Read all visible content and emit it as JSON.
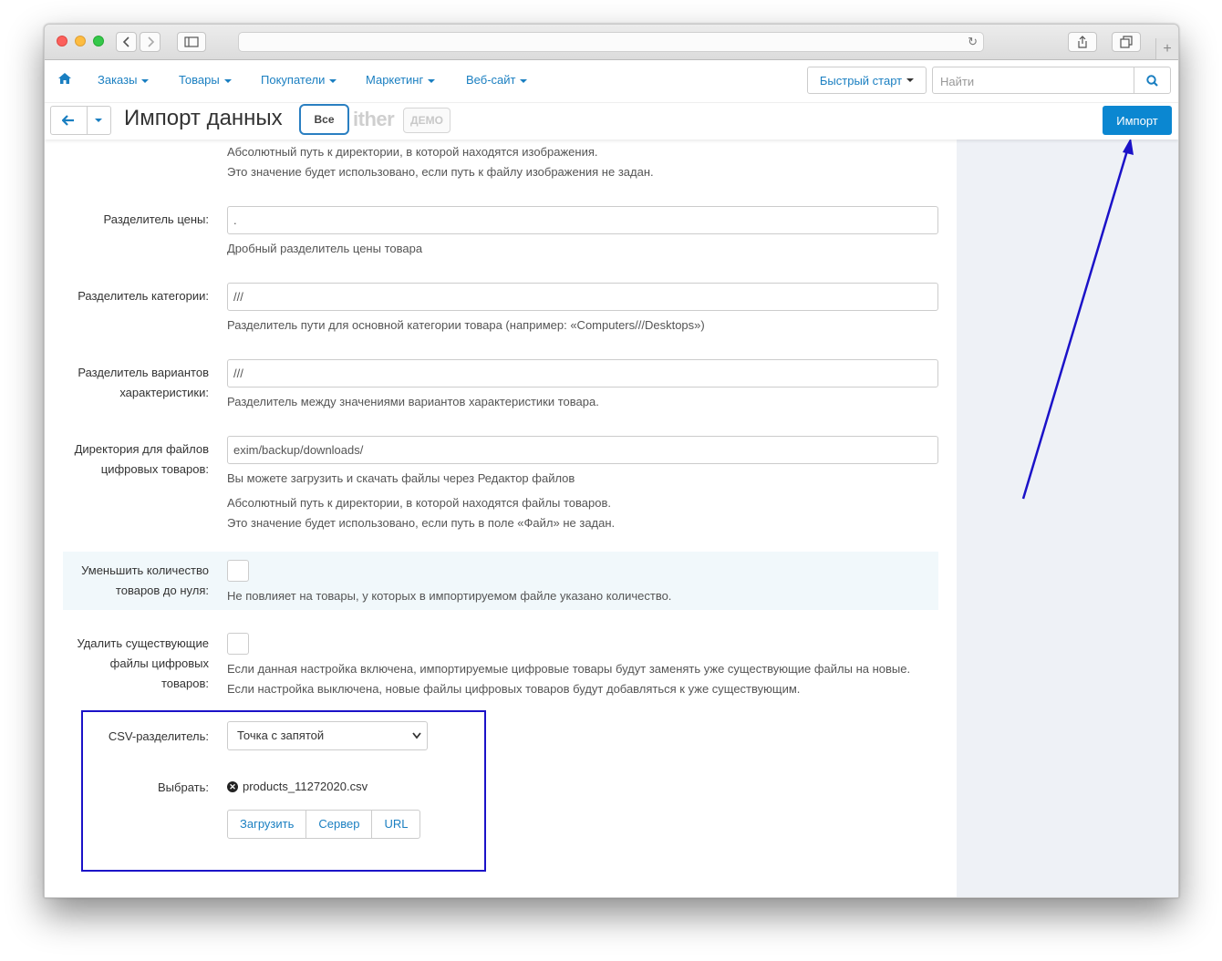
{
  "nav": {
    "items": [
      "Заказы",
      "Товары",
      "Покупатели",
      "Маркетинг",
      "Веб-сайт"
    ],
    "quick_start": "Быстрый старт",
    "search_placeholder": "Найти"
  },
  "toolbar": {
    "title": "Импорт данных",
    "vse_label": "Все",
    "logo_text": "ither",
    "demo_text": "ДЕМО",
    "import_label": "Импорт"
  },
  "form": {
    "images_dir_help1": "Абсолютный путь к директории, в которой находятся изображения.",
    "images_dir_help2": "Это значение будет использовано, если путь к файлу изображения не задан.",
    "price_sep": {
      "label": "Разделитель цены:",
      "value": ".",
      "help": "Дробный разделитель цены товара"
    },
    "cat_sep": {
      "label": "Разделитель категории:",
      "value": "///",
      "help": "Разделитель пути для основной категории товара (например: «Computers///Desktops»)"
    },
    "variant_sep": {
      "label1": "Разделитель вариантов",
      "label2": "характеристики:",
      "value": "///",
      "help": "Разделитель между значениями вариантов характеристики товара."
    },
    "digital_dir": {
      "label1": "Директория для файлов",
      "label2": "цифровых товаров:",
      "value": "exim/backup/downloads/",
      "help1": "Вы можете загрузить и скачать файлы через Редактор файлов",
      "help2": "Абсолютный путь к директории, в которой находятся файлы товаров.",
      "help3": "Это значение будет использовано, если путь в поле «Файл» не задан."
    },
    "reduce_qty": {
      "label1": "Уменьшить количество",
      "label2": "товаров до нуля:",
      "help": "Не повлияет на товары, у которых в импортируемом файле указано количество."
    },
    "delete_files": {
      "label1": "Удалить существующие",
      "label2": "файлы цифровых",
      "label3": "товаров:",
      "help1": "Если данная настройка включена, импортируемые цифровые товары будут заменять уже существующие файлы на новые.",
      "help2": "Если настройка выключена, новые файлы цифровых товаров будут добавляться к уже существующим."
    },
    "csv_sep": {
      "label": "CSV-разделитель:",
      "selected": "Точка с запятой"
    },
    "choose": {
      "label": "Выбрать:",
      "filename": "products_11272020.csv",
      "upload": "Загрузить",
      "server": "Сервер",
      "url": "URL"
    }
  },
  "colors": {
    "accent": "#0b87d1",
    "link": "#1a7fc1",
    "annotation": "#1b12c8"
  }
}
